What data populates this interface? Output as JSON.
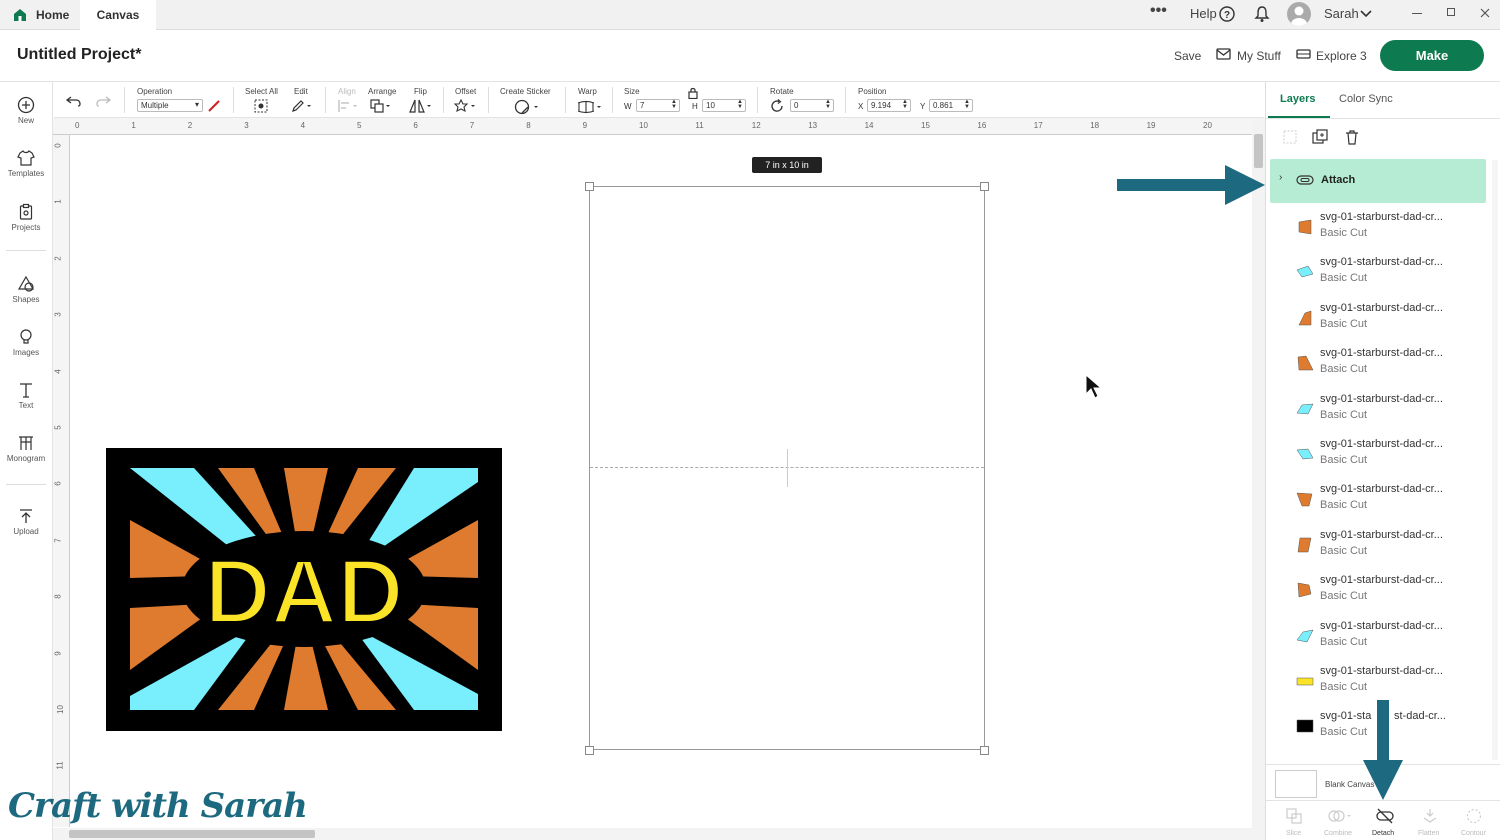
{
  "topbar": {
    "home_label": "Home",
    "canvas_label": "Canvas",
    "help_label": "Help",
    "user_name": "Sarah"
  },
  "header": {
    "project_title": "Untitled Project*",
    "save_label": "Save",
    "my_stuff_label": "My Stuff",
    "machine_label": "Explore 3",
    "make_label": "Make"
  },
  "left_rail": {
    "items": [
      {
        "label": "New",
        "icon": "plus-circle-icon"
      },
      {
        "label": "Templates",
        "icon": "shirt-icon"
      },
      {
        "label": "Projects",
        "icon": "clipboard-icon"
      },
      {
        "label": "Shapes",
        "icon": "shapes-icon"
      },
      {
        "label": "Images",
        "icon": "bulb-icon"
      },
      {
        "label": "Text",
        "icon": "text-icon"
      },
      {
        "label": "Monogram",
        "icon": "monogram-icon"
      },
      {
        "label": "Upload",
        "icon": "upload-icon"
      }
    ]
  },
  "toolbar": {
    "operation_label": "Operation",
    "operation_value": "Multiple",
    "select_all_label": "Select All",
    "edit_label": "Edit",
    "align_label": "Align",
    "arrange_label": "Arrange",
    "flip_label": "Flip",
    "offset_label": "Offset",
    "create_sticker_label": "Create Sticker",
    "warp_label": "Warp",
    "size_label": "Size",
    "w_label": "W",
    "w_value": "7",
    "h_label": "H",
    "h_value": "10",
    "rotate_label": "Rotate",
    "rotate_value": "0",
    "position_label": "Position",
    "x_label": "X",
    "x_value": "9.194",
    "y_label": "Y",
    "y_value": "0.861"
  },
  "ruler": {
    "top_ticks": [
      "0",
      "1",
      "2",
      "3",
      "4",
      "5",
      "6",
      "7",
      "8",
      "9",
      "10",
      "11",
      "12",
      "13",
      "14",
      "15",
      "16",
      "17",
      "18",
      "19",
      "20"
    ],
    "left_ticks": [
      "0",
      "1",
      "2",
      "3",
      "4",
      "5",
      "6",
      "7",
      "8",
      "9",
      "10",
      "11"
    ]
  },
  "canvas": {
    "size_badge": "7 in x 10 in",
    "design_text": "DAD",
    "colors": {
      "black": "#000000",
      "cyan": "#79eefc",
      "orange": "#de7b2e",
      "yellow": "#fbe427"
    }
  },
  "panel": {
    "tab_layers": "Layers",
    "tab_color_sync": "Color Sync",
    "group_label": "Attach",
    "layers": [
      {
        "name": "svg-01-starburst-dad-cr...",
        "sub": "Basic Cut",
        "color": "#de7b2e"
      },
      {
        "name": "svg-01-starburst-dad-cr...",
        "sub": "Basic Cut",
        "color": "#79eefc"
      },
      {
        "name": "svg-01-starburst-dad-cr...",
        "sub": "Basic Cut",
        "color": "#de7b2e"
      },
      {
        "name": "svg-01-starburst-dad-cr...",
        "sub": "Basic Cut",
        "color": "#de7b2e"
      },
      {
        "name": "svg-01-starburst-dad-cr...",
        "sub": "Basic Cut",
        "color": "#79eefc"
      },
      {
        "name": "svg-01-starburst-dad-cr...",
        "sub": "Basic Cut",
        "color": "#79eefc"
      },
      {
        "name": "svg-01-starburst-dad-cr...",
        "sub": "Basic Cut",
        "color": "#de7b2e"
      },
      {
        "name": "svg-01-starburst-dad-cr...",
        "sub": "Basic Cut",
        "color": "#de7b2e"
      },
      {
        "name": "svg-01-starburst-dad-cr...",
        "sub": "Basic Cut",
        "color": "#de7b2e"
      },
      {
        "name": "svg-01-starburst-dad-cr...",
        "sub": "Basic Cut",
        "color": "#79eefc"
      },
      {
        "name": "svg-01-starburst-dad-cr...",
        "sub": "Basic Cut",
        "color": "#fbe427"
      },
      {
        "name": "svg-01-sta",
        "name_tail": "st-dad-cr...",
        "sub": "Basic Cut",
        "color": "#000000"
      }
    ],
    "blank_canvas_label": "Blank Canvas",
    "actions": [
      "Slice",
      "Combine",
      "Detach",
      "Flatten",
      "Contour"
    ]
  },
  "watermark": "Craft with Sarah"
}
